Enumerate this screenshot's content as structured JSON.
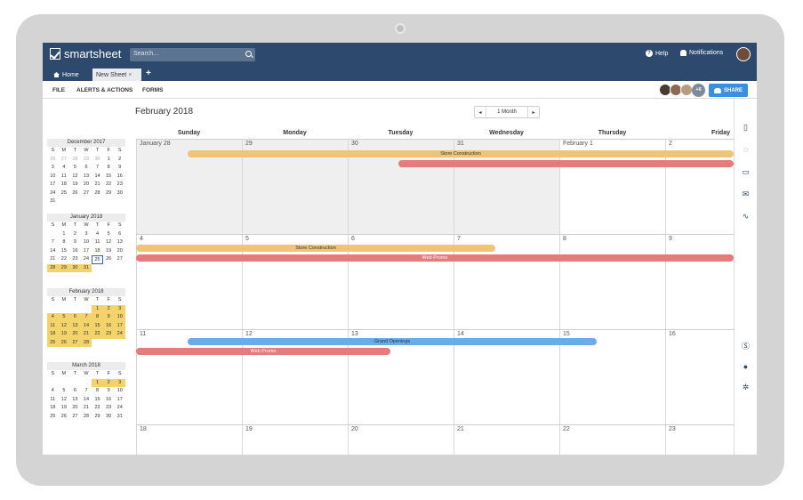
{
  "app": {
    "logo_text": "smartsheet",
    "search_placeholder": "Search...",
    "help_label": "Help",
    "notifications_label": "Notifications"
  },
  "tabs": {
    "home_label": "Home",
    "sheet_label": "New Sheet",
    "add_label": "+"
  },
  "toolbar": {
    "file_label": "FILE",
    "alerts_label": "ALERTS & ACTIONS",
    "forms_label": "FORMS",
    "collab_more": "+6",
    "share_label": "SHARE"
  },
  "calendar": {
    "month_title": "February 2018",
    "view_label": "1 Month",
    "prev_icon": "◂",
    "next_icon": "▸",
    "weekdays": [
      "Sunday",
      "Monday",
      "Tuesday",
      "Wednesday",
      "Thursday",
      "Friday"
    ],
    "weeks": [
      [
        "January 28",
        "29",
        "30",
        "31",
        "February 1",
        "2"
      ],
      [
        "4",
        "5",
        "6",
        "7",
        "8",
        "9"
      ],
      [
        "11",
        "12",
        "13",
        "14",
        "15",
        "16"
      ],
      [
        "18",
        "19",
        "20",
        "21",
        "22",
        "23"
      ]
    ],
    "events": {
      "store_construction": "Store Construction",
      "web_promo": "Web Promo",
      "grand_openings": "Grand Openings"
    },
    "colors": {
      "orange": "#f0c477",
      "red": "#e57b7b",
      "blue": "#6aabea"
    }
  },
  "mini_calendars": [
    {
      "title": "December 2017",
      "days": [
        "S",
        "M",
        "T",
        "W",
        "T",
        "F",
        "S"
      ],
      "rows": [
        [
          "26",
          "27",
          "28",
          "29",
          "30",
          "1",
          "2"
        ],
        [
          "3",
          "4",
          "5",
          "6",
          "7",
          "8",
          "9"
        ],
        [
          "10",
          "11",
          "12",
          "13",
          "14",
          "15",
          "16"
        ],
        [
          "17",
          "18",
          "19",
          "20",
          "21",
          "22",
          "23"
        ],
        [
          "24",
          "25",
          "26",
          "27",
          "28",
          "29",
          "30"
        ],
        [
          "31",
          "",
          "",
          "",
          "",
          "",
          ""
        ]
      ]
    },
    {
      "title": "January 2018",
      "days": [
        "S",
        "M",
        "T",
        "W",
        "T",
        "F",
        "S"
      ],
      "rows": [
        [
          "",
          "1",
          "2",
          "3",
          "4",
          "5",
          "6"
        ],
        [
          "7",
          "8",
          "9",
          "10",
          "11",
          "12",
          "13"
        ],
        [
          "14",
          "15",
          "16",
          "17",
          "18",
          "19",
          "20"
        ],
        [
          "21",
          "22",
          "23",
          "24",
          "25",
          "26",
          "27"
        ],
        [
          "28",
          "29",
          "30",
          "31",
          "",
          "",
          ""
        ]
      ]
    },
    {
      "title": "February 2018",
      "days": [
        "S",
        "M",
        "T",
        "W",
        "T",
        "F",
        "S"
      ],
      "rows": [
        [
          "",
          "",
          "",
          "",
          "1",
          "2",
          "3"
        ],
        [
          "4",
          "5",
          "6",
          "7",
          "8",
          "9",
          "10"
        ],
        [
          "11",
          "12",
          "13",
          "14",
          "15",
          "16",
          "17"
        ],
        [
          "18",
          "19",
          "20",
          "21",
          "22",
          "23",
          "24"
        ],
        [
          "25",
          "26",
          "27",
          "28",
          "",
          "",
          ""
        ]
      ]
    },
    {
      "title": "March 2018",
      "days": [
        "S",
        "M",
        "T",
        "W",
        "T",
        "F",
        "S"
      ],
      "rows": [
        [
          "",
          "",
          "",
          "",
          "1",
          "2",
          "3"
        ],
        [
          "4",
          "5",
          "6",
          "7",
          "8",
          "9",
          "10"
        ],
        [
          "11",
          "12",
          "13",
          "14",
          "15",
          "16",
          "17"
        ],
        [
          "18",
          "19",
          "20",
          "21",
          "22",
          "23",
          "24"
        ],
        [
          "25",
          "26",
          "27",
          "28",
          "29",
          "30",
          "31"
        ]
      ]
    }
  ],
  "right_panel_icons": [
    "sheet-icon",
    "attachment-icon",
    "comment-icon",
    "update-request-icon",
    "activity-icon",
    "skype-icon",
    "chat-icon",
    "integration-icon"
  ]
}
